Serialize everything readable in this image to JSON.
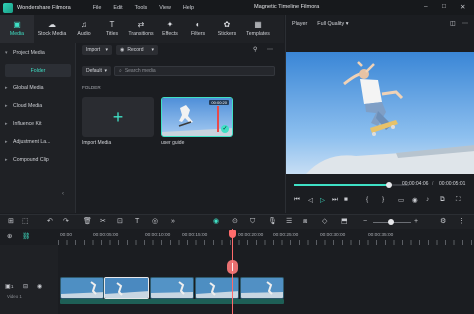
{
  "window": {
    "app_title": "Wondershare Filmora",
    "menu": [
      "File",
      "Edit",
      "Tools",
      "View",
      "Help"
    ],
    "project_title": "Magnetic Timeline Filmora",
    "accent_color": "#3fe0c5",
    "playhead_color": "#ff6b6b"
  },
  "resource_tabs": [
    {
      "label": "Media",
      "icon": "media-icon",
      "glyph": "▣",
      "active": true
    },
    {
      "label": "Stock Media",
      "icon": "stock-media-icon",
      "glyph": "☁",
      "active": false
    },
    {
      "label": "Audio",
      "icon": "audio-icon",
      "glyph": "♫",
      "active": false
    },
    {
      "label": "Titles",
      "icon": "titles-icon",
      "glyph": "T",
      "active": false
    },
    {
      "label": "Transitions",
      "icon": "transitions-icon",
      "glyph": "⇄",
      "active": false
    },
    {
      "label": "Effects",
      "icon": "effects-icon",
      "glyph": "✦",
      "active": false
    },
    {
      "label": "Filters",
      "icon": "filters-icon",
      "glyph": "◐",
      "active": false
    },
    {
      "label": "Stickers",
      "icon": "stickers-icon",
      "glyph": "✿",
      "active": false
    },
    {
      "label": "Templates",
      "icon": "templates-icon",
      "glyph": "▦",
      "active": false
    }
  ],
  "sidebar": {
    "project_media": "Project Media",
    "folder": "Folder",
    "items": [
      "Global Media",
      "Cloud Media",
      "Influence Kit",
      "Adjustment La...",
      "Compound Clip"
    ]
  },
  "media": {
    "import_label": "Import",
    "record_label": "Record",
    "sort_label": "Default",
    "search_placeholder": "Search media",
    "folder_heading": "FOLDER",
    "import_tile_label": "Import Media",
    "clip_label": "user guide",
    "clip_duration": "00:00:20"
  },
  "player": {
    "label": "Player",
    "quality": "Full Quality",
    "current_time": "00:00:04:06",
    "total_time": "00:00:05:01",
    "progress": 0.83
  },
  "timeline": {
    "ruler_labels": [
      "00:00",
      "00:00:05:00",
      "00:00:10:00",
      "00:00:15:00",
      "00:00:20:00",
      "00:00:25:00",
      "00:00:30:00",
      "00:00:35:00"
    ],
    "track_label": "Video 1",
    "track_number": "1"
  }
}
